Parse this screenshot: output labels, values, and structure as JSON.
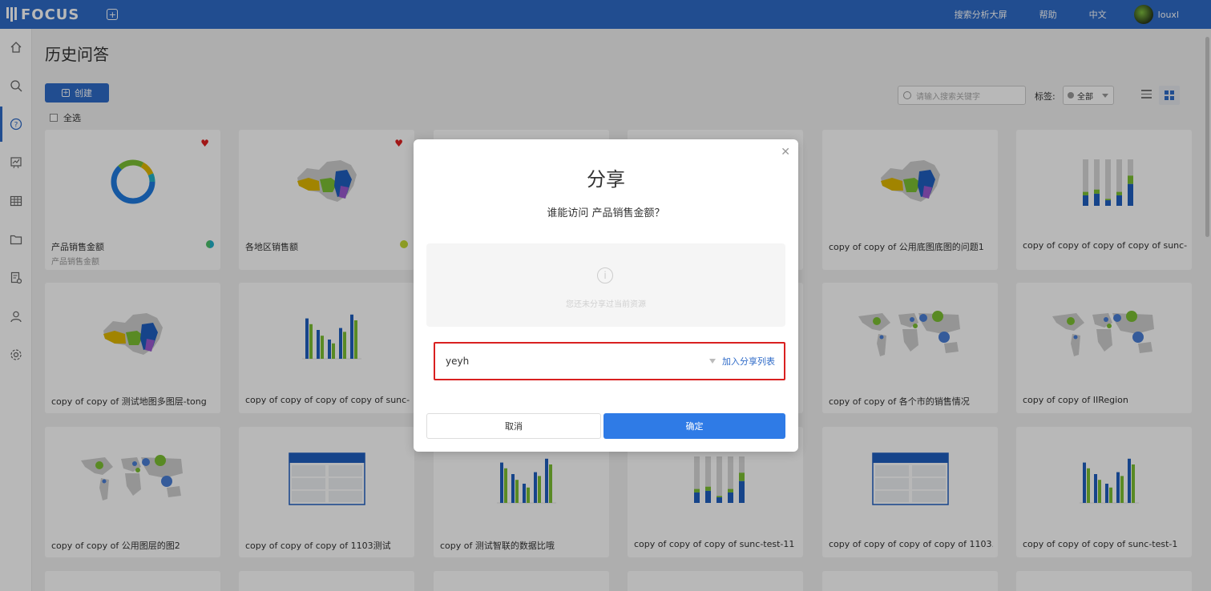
{
  "app": {
    "logo_text": "FOCUS",
    "new_tab_icon": "plus-square-icon",
    "nav_links": [
      "搜索分析大屏",
      "帮助",
      "中文"
    ],
    "username": "louxl"
  },
  "sidebar": {
    "icons": [
      "home-icon",
      "search-icon",
      "question-icon",
      "dashboard-icon",
      "table-icon",
      "folder-icon",
      "settings-doc-icon",
      "user-icon",
      "gear-icon"
    ],
    "active_index": 2
  },
  "page": {
    "title": "历史问答",
    "create_label": "创建",
    "select_all_label": "全选",
    "search_placeholder": "请输入搜索关键字",
    "tag_label": "标签:",
    "tag_value": "全部"
  },
  "cards": [
    {
      "title": "产品销售金额",
      "subtitle": "产品销售金额",
      "thumb": "donut",
      "favorite": true,
      "tag_color": "#4bbf6b"
    },
    {
      "title": "各地区销售额",
      "subtitle": "",
      "thumb": "china-map",
      "favorite": true,
      "tag_color": "#c4d932"
    },
    {
      "title": "",
      "subtitle": "",
      "thumb": "hidden",
      "favorite": false,
      "tag_color": ""
    },
    {
      "title": "",
      "subtitle": "",
      "thumb": "hidden",
      "favorite": false,
      "tag_color": ""
    },
    {
      "title": "copy of copy of 公用底图底图的问题1",
      "subtitle": "",
      "thumb": "china-map",
      "favorite": false,
      "tag_color": ""
    },
    {
      "title": "copy of copy of copy of copy of sunc-t...",
      "subtitle": "",
      "thumb": "stacked-bar",
      "favorite": false,
      "tag_color": ""
    },
    {
      "title": "copy of copy of 测试地图多图层-tong",
      "subtitle": "",
      "thumb": "china-map",
      "favorite": false,
      "tag_color": ""
    },
    {
      "title": "copy of copy of copy of copy of sunc-t...",
      "subtitle": "",
      "thumb": "grouped-bar",
      "favorite": false,
      "tag_color": ""
    },
    {
      "title": "",
      "subtitle": "",
      "thumb": "hidden",
      "favorite": false,
      "tag_color": ""
    },
    {
      "title": "",
      "subtitle": "",
      "thumb": "hidden",
      "favorite": false,
      "tag_color": ""
    },
    {
      "title": "copy of copy of 各个市的销售情况",
      "subtitle": "",
      "thumb": "world-map",
      "favorite": false,
      "tag_color": ""
    },
    {
      "title": "copy of copy of IIRegion",
      "subtitle": "",
      "thumb": "world-map",
      "favorite": false,
      "tag_color": ""
    },
    {
      "title": "copy of copy of 公用图层的图2",
      "subtitle": "",
      "thumb": "world-map",
      "favorite": false,
      "tag_color": ""
    },
    {
      "title": "copy of copy of copy of 1103测试",
      "subtitle": "",
      "thumb": "table",
      "favorite": false,
      "tag_color": ""
    },
    {
      "title": "copy of 测试智联的数据比哦",
      "subtitle": "",
      "thumb": "grouped-bar",
      "favorite": false,
      "tag_color": ""
    },
    {
      "title": "copy of copy of copy of sunc-test-11",
      "subtitle": "",
      "thumb": "stacked-bar",
      "favorite": false,
      "tag_color": ""
    },
    {
      "title": "copy of copy of copy of copy of 1103...",
      "subtitle": "",
      "thumb": "table",
      "favorite": false,
      "tag_color": ""
    },
    {
      "title": "copy of copy of copy of sunc-test-1",
      "subtitle": "",
      "thumb": "grouped-bar",
      "favorite": false,
      "tag_color": ""
    }
  ],
  "modal": {
    "title": "分享",
    "subtitle": "谁能访问 产品销售金额？",
    "empty_message": "您还未分享过当前资源",
    "user_value": "yeyh",
    "add_label": "加入分享列表",
    "cancel_label": "取消",
    "ok_label": "确定"
  },
  "colors": {
    "primary": "#2f6bc8",
    "confirm": "#2f7be6",
    "highlight": "#d92020",
    "green": "#7cc033",
    "blue": "#1f5fbf"
  }
}
